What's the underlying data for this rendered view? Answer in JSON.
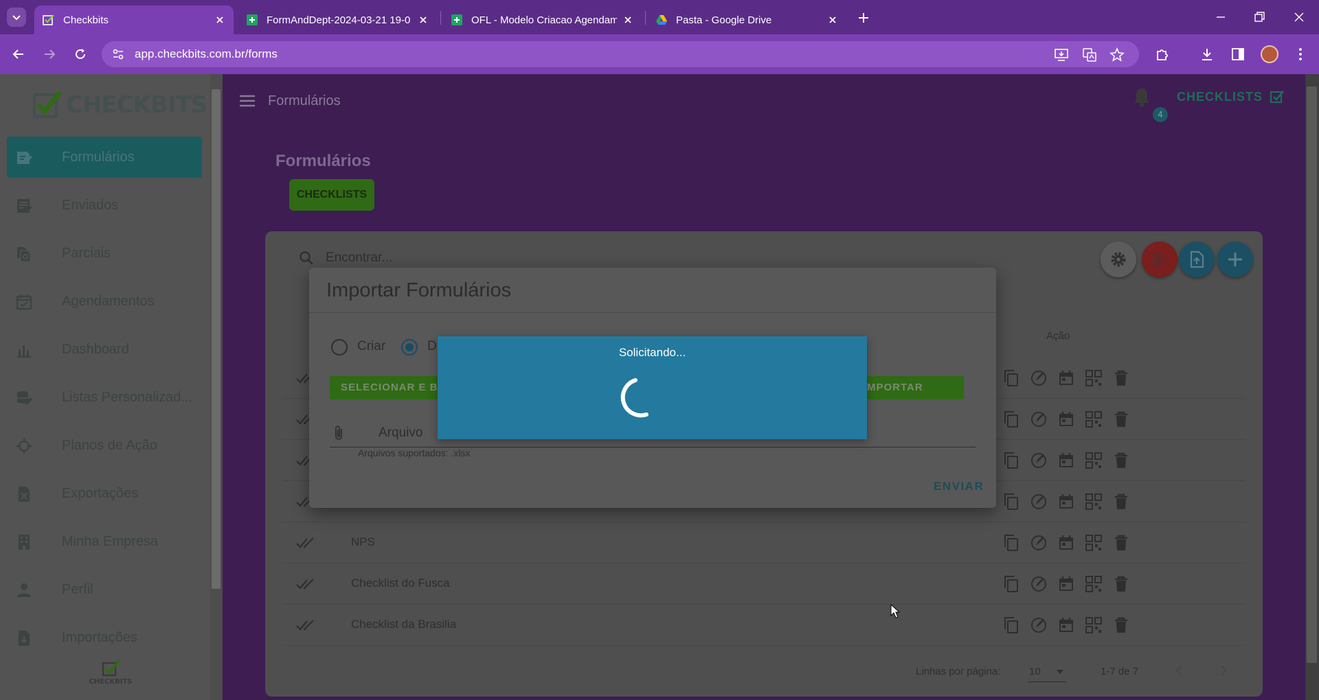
{
  "browser": {
    "tabs": [
      {
        "title": "Checkbits",
        "active": true,
        "favicon": "checkbits-favicon"
      },
      {
        "title": "FormAndDept-2024-03-21 19-0",
        "active": false,
        "favicon": "sheets-icon"
      },
      {
        "title": "OFL - Modelo Criacao Agendam",
        "active": false,
        "favicon": "sheets-icon"
      },
      {
        "title": "Pasta - Google Drive",
        "active": false,
        "favicon": "drive-icon"
      }
    ],
    "url": "app.checkbits.com.br/forms",
    "colors": {
      "frame": "#5b2c87",
      "toolbar": "#7b3fb4"
    }
  },
  "app": {
    "logo_text": "CHECKBITS",
    "bottom_logo_text": "CHECKBITS",
    "sidebar": {
      "items": [
        {
          "label": "Formulários",
          "icon": "forms-icon",
          "active": true
        },
        {
          "label": "Enviados",
          "icon": "sent-icon",
          "active": false
        },
        {
          "label": "Parciais",
          "icon": "partial-icon",
          "active": false
        },
        {
          "label": "Agendamentos",
          "icon": "calendar-icon",
          "active": false
        },
        {
          "label": "Dashboard",
          "icon": "bar-chart-icon",
          "active": false
        },
        {
          "label": "Listas Personalizad...",
          "icon": "database-icon",
          "active": false
        },
        {
          "label": "Planos de Ação",
          "icon": "crosshair-icon",
          "active": false
        },
        {
          "label": "Exportações",
          "icon": "excel-file-icon",
          "active": false
        },
        {
          "label": "Minha Empresa",
          "icon": "building-icon",
          "active": false
        },
        {
          "label": "Perfil",
          "icon": "person-icon",
          "active": false
        },
        {
          "label": "Importações",
          "icon": "import-file-icon",
          "active": false
        }
      ]
    },
    "header": {
      "title": "Formulários",
      "notification_count": "4",
      "checklists_label": "CHECKLISTS"
    },
    "page": {
      "heading": "Formulários",
      "chip_label": "CHECKLISTS"
    },
    "table": {
      "search_placeholder": "Encontrar...",
      "action_header": "Ação",
      "rows": [
        {
          "name": ""
        },
        {
          "name": ""
        },
        {
          "name": ""
        },
        {
          "name": ""
        },
        {
          "name": "NPS"
        },
        {
          "name": "Checklist do Fusca"
        },
        {
          "name": "Checklist da Brasilia"
        }
      ],
      "rows_per_page_label": "Linhas por página:",
      "rows_per_page": "10",
      "range": "1-7 de 7"
    },
    "import_dialog": {
      "title": "Importar Formulários",
      "options": [
        {
          "label": "Criar",
          "checked": false
        },
        {
          "label": "D",
          "checked": true
        }
      ],
      "select_button": "SELECIONAR E BA",
      "import_button": "MPORTAR",
      "file_label": "Arquivo",
      "file_hint": "Arquivos suportados: .xlsx",
      "send_label": "ENVIAR"
    },
    "loading": {
      "text": "Solicitando..."
    },
    "colors": {
      "accent_green": "#2f6a14",
      "active_nav": "#1a5b5e",
      "loader_blue": "#23799e",
      "delete_red": "#7a1e1e",
      "fab_blue": "#1c4f63"
    }
  }
}
